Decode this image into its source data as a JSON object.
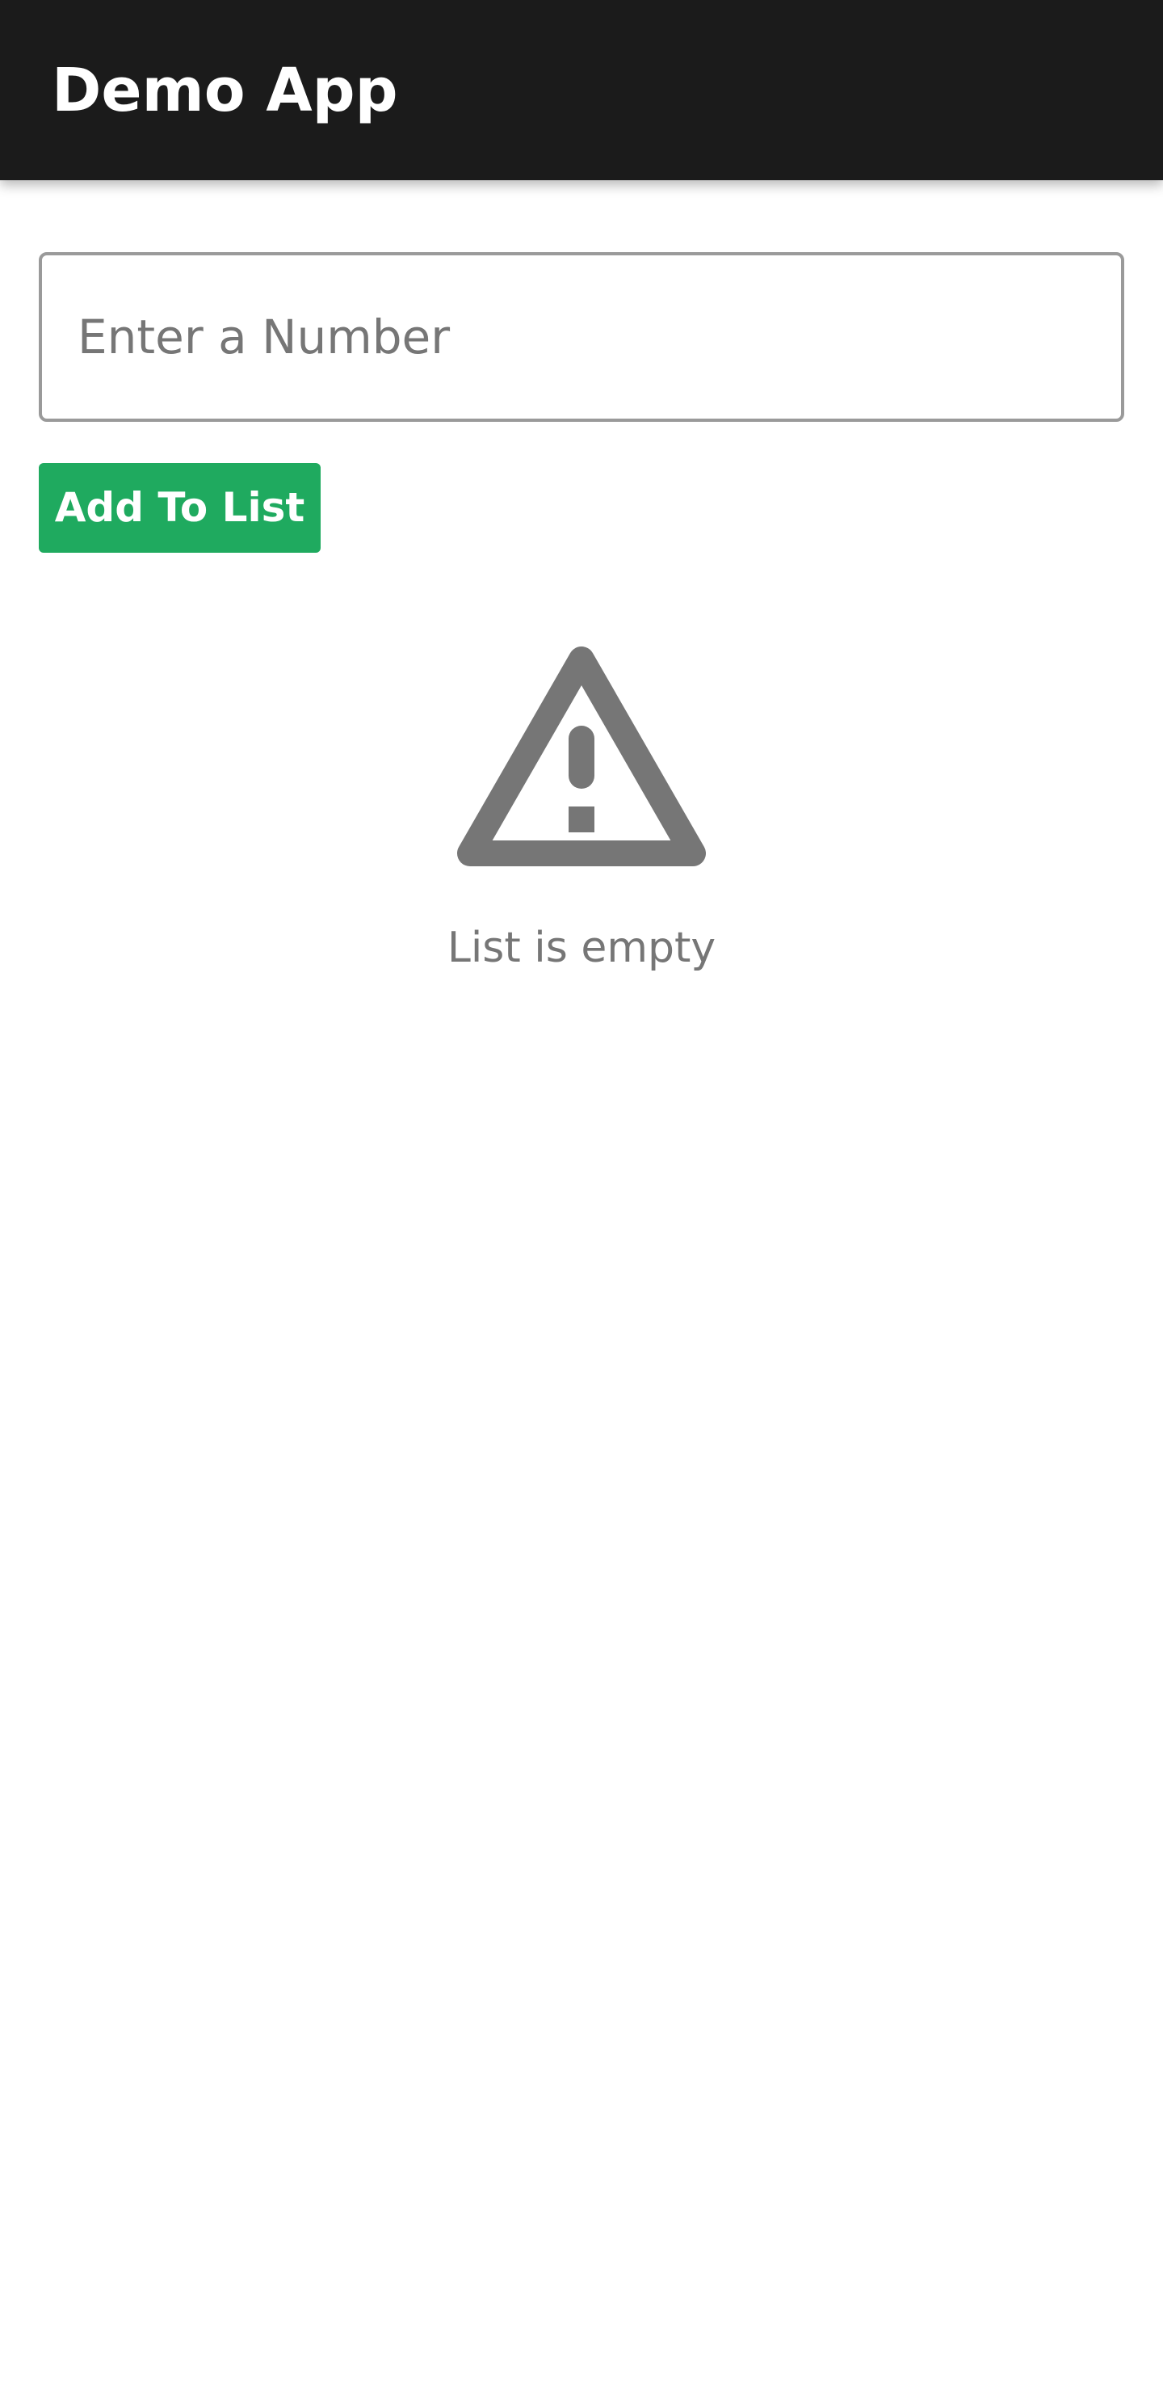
{
  "app_bar": {
    "title": "Demo App",
    "background_color": "#1b1b1b"
  },
  "form": {
    "number_input": {
      "value": "",
      "placeholder": "Enter a Number"
    },
    "add_button": {
      "label": "Add To List",
      "color": "#1faa5f"
    }
  },
  "empty_state": {
    "icon": "warning-triangle-icon",
    "message": "List is empty",
    "color": "#767676"
  }
}
